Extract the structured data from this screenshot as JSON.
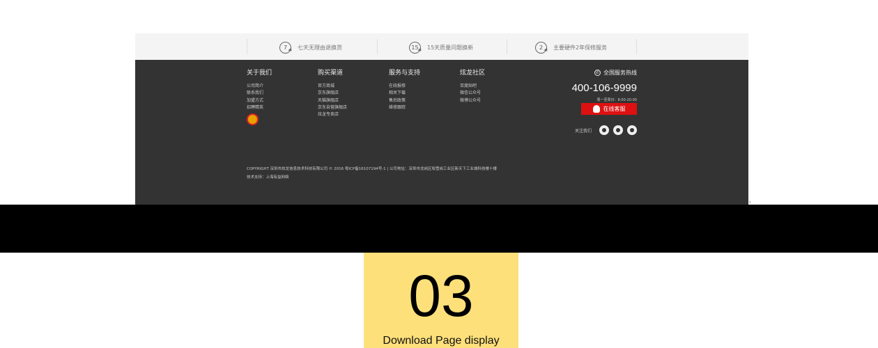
{
  "services": [
    {
      "num": "7",
      "label": "七天无理由退换货"
    },
    {
      "num": "15",
      "label": "15天质量问题换新"
    },
    {
      "num": "2",
      "label": "主要硬件2年保修服务"
    }
  ],
  "footer_columns": [
    {
      "title": "关于我们",
      "items": [
        "公司简介",
        "联系我们",
        "加盟方式",
        "招聘精英"
      ]
    },
    {
      "title": "购买渠道",
      "items": [
        "官方商城",
        "京东旗舰店",
        "天猫旗舰店",
        "京东自营旗舰店",
        "炫龙专卖店"
      ]
    },
    {
      "title": "服务与支持",
      "items": [
        "在线报修",
        "相关下载",
        "售后政策",
        "维修跟踪"
      ]
    },
    {
      "title": "炫龙社区",
      "items": [
        "百度贴吧",
        "微信公众号",
        "微博公众号"
      ]
    }
  ],
  "hotline": {
    "label": "全国服务热线",
    "number": "400-106-9999",
    "hours": "周一至周日：8:00-20:00",
    "chat_button": "在线客服",
    "follow_label": "关注我们"
  },
  "copyright": {
    "line1": "COPYRIGHT 深圳市炫龙信息技术科技有限公司 © 2016 粤ICP备16107194号-1 | 公司地址：深圳市龙岗区坂雪岗工业区新天下工业城科技楼十楼",
    "line2": "技术支持：上海有益网络"
  },
  "step": {
    "number": "03",
    "label": "Download Page display"
  },
  "colors": {
    "footer_bg": "#333333",
    "chat_button_bg": "#dd1111",
    "step_bg": "#fde07a",
    "band": "#000000"
  },
  "icons": [
    "service-7-icon",
    "service-15-icon",
    "service-2-icon",
    "police-badge-icon",
    "phone-icon",
    "qq-icon",
    "weibo-icon",
    "wechat-icon",
    "baidu-icon"
  ]
}
